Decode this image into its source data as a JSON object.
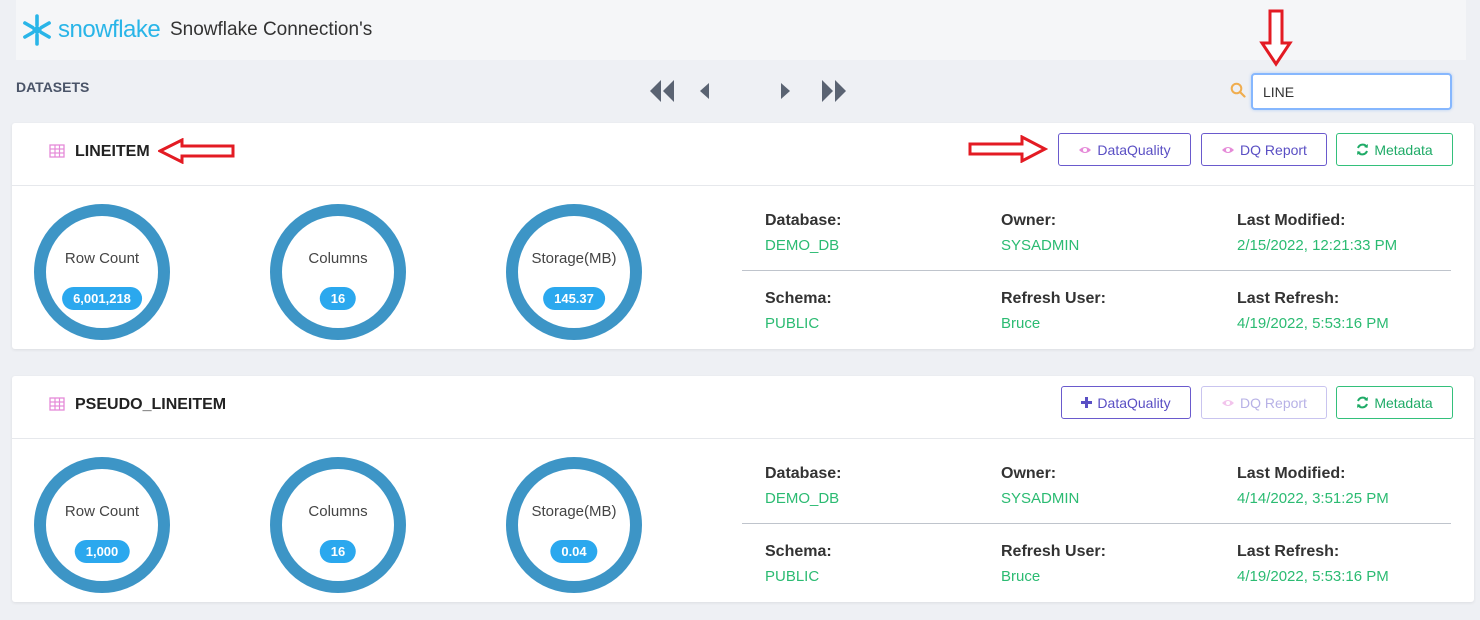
{
  "header": {
    "logo_text": "snowflake",
    "title": "Snowflake Connection's"
  },
  "toolbar": {
    "datasets_label": "DATASETS",
    "search_value": "LINE",
    "pager": [
      "first-page-icon",
      "prev-page-icon",
      "next-page-icon",
      "last-page-icon"
    ]
  },
  "colors": {
    "brand": "#29b5e8",
    "gauge_ring": "#3d95c6",
    "badge": "#2ba8ee",
    "value_green": "#2bbb72",
    "button_purple": "#6a5acd",
    "button_green": "#33c07b",
    "annotation_red": "#e31b23"
  },
  "datasets": [
    {
      "name": "LINEITEM",
      "buttons": {
        "dataquality": "DataQuality",
        "dataquality_icon": "eye-icon",
        "dq_report": "DQ Report",
        "dq_report_enabled": true,
        "metadata": "Metadata"
      },
      "stats": {
        "row_count_label": "Row Count",
        "row_count": "6,001,218",
        "columns_label": "Columns",
        "columns": "16",
        "storage_label": "Storage(MB)",
        "storage": "145.37"
      },
      "info": {
        "database_label": "Database:",
        "database": "DEMO_DB",
        "owner_label": "Owner:",
        "owner": "SYSADMIN",
        "last_modified_label": "Last Modified:",
        "last_modified": "2/15/2022, 12:21:33 PM",
        "schema_label": "Schema:",
        "schema": "PUBLIC",
        "refresh_user_label": "Refresh User:",
        "refresh_user": "Bruce",
        "last_refresh_label": "Last Refresh:",
        "last_refresh": "4/19/2022, 5:53:16 PM"
      }
    },
    {
      "name": "PSEUDO_LINEITEM",
      "buttons": {
        "dataquality": "DataQuality",
        "dataquality_icon": "plus-icon",
        "dq_report": "DQ Report",
        "dq_report_enabled": false,
        "metadata": "Metadata"
      },
      "stats": {
        "row_count_label": "Row Count",
        "row_count": "1,000",
        "columns_label": "Columns",
        "columns": "16",
        "storage_label": "Storage(MB)",
        "storage": "0.04"
      },
      "info": {
        "database_label": "Database:",
        "database": "DEMO_DB",
        "owner_label": "Owner:",
        "owner": "SYSADMIN",
        "last_modified_label": "Last Modified:",
        "last_modified": "4/14/2022, 3:51:25 PM",
        "schema_label": "Schema:",
        "schema": "PUBLIC",
        "refresh_user_label": "Refresh User:",
        "refresh_user": "Bruce",
        "last_refresh_label": "Last Refresh:",
        "last_refresh": "4/19/2022, 5:53:16 PM"
      }
    }
  ]
}
